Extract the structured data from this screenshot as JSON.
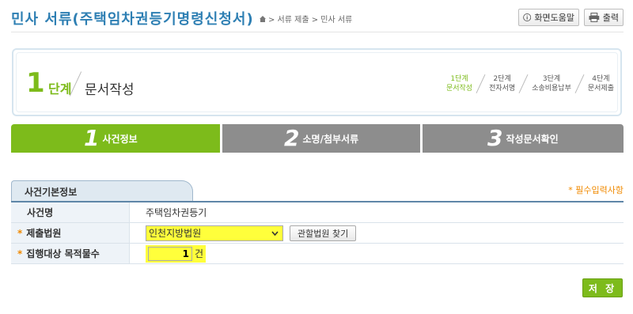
{
  "header": {
    "title": "민사 서류(주택임차권등기명령신청서)",
    "breadcrumb": "> 서류 제출 > 민사 서류",
    "help_label": "화면도움말",
    "print_label": "출력"
  },
  "stepbox": {
    "current_number": "1",
    "current_dan": "단계",
    "current_name": "문서작성",
    "steps": [
      {
        "num": "1단계",
        "name": "문서작성"
      },
      {
        "num": "2단계",
        "name": "전자서명"
      },
      {
        "num": "3단계",
        "name": "소송비용납부"
      },
      {
        "num": "4단계",
        "name": "문서제출"
      }
    ]
  },
  "tabs": [
    {
      "num": "1",
      "label": "사건정보"
    },
    {
      "num": "2",
      "label": "소명/첨부서류"
    },
    {
      "num": "3",
      "label": "작성문서확인"
    }
  ],
  "section": {
    "title": "사건기본정보",
    "required_note": "* 필수입력사항"
  },
  "form": {
    "case_name_label": "사건명",
    "case_name_value": "주택임차권등기",
    "court_label": "제출법원",
    "court_value": "인천지방법원",
    "find_court_label": "관할법원 찾기",
    "count_label": "집행대상 목적물수",
    "count_value": "1",
    "count_unit": "건"
  },
  "save_label": "저 장",
  "colors": {
    "accent_green": "#7dbb1b",
    "title_blue": "#2e7fb3",
    "highlight_yellow": "#ffff3b",
    "required_orange": "#f08a00"
  }
}
